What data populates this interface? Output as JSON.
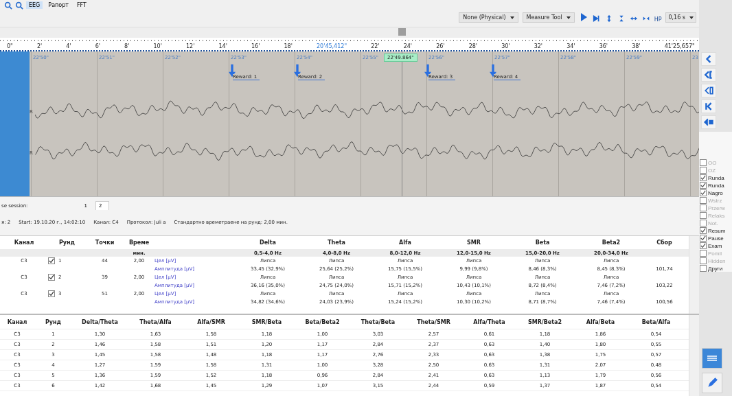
{
  "toolbar": {
    "buttons": [
      {
        "label": "EEG"
      },
      {
        "label": "Рапорт"
      },
      {
        "label": "FFT"
      }
    ],
    "montage": "None (Physical)",
    "tool": "Measure Tool",
    "hp_label": "HP",
    "hp_value": "0,16 s"
  },
  "ruler": {
    "ticks": [
      {
        "label": "0\"",
        "kind": "plain"
      },
      {
        "label": "2'",
        "kind": "plain"
      },
      {
        "label": "4'",
        "kind": "plain"
      },
      {
        "label": "6'",
        "kind": "plain"
      },
      {
        "label": "8'",
        "kind": "plain"
      },
      {
        "label": "10'",
        "kind": "plain"
      },
      {
        "label": "12'",
        "kind": "plain"
      },
      {
        "label": "14'",
        "kind": "plain"
      },
      {
        "label": "16'",
        "kind": "plain"
      },
      {
        "label": "18'",
        "kind": "plain"
      },
      {
        "label": "20'45,412\"",
        "kind": "current"
      },
      {
        "label": "22'",
        "kind": "plain"
      },
      {
        "label": "24'",
        "kind": "plain"
      },
      {
        "label": "26'",
        "kind": "plain"
      },
      {
        "label": "28'",
        "kind": "plain"
      },
      {
        "label": "30'",
        "kind": "plain"
      },
      {
        "label": "32'",
        "kind": "plain"
      },
      {
        "label": "34'",
        "kind": "plain"
      },
      {
        "label": "36'",
        "kind": "plain"
      },
      {
        "label": "38'",
        "kind": "plain"
      },
      {
        "label": "41'25,657\"",
        "kind": "plain"
      }
    ]
  },
  "eeg": {
    "time_labels": [
      "22'50\"",
      "22'51\"",
      "22'52\"",
      "22'53\"",
      "22'54\"",
      "22'55\"",
      "22'56\"",
      "22'57\"",
      "22'58\"",
      "22'59\"",
      "23"
    ],
    "cursor_time": "22'49.864\"",
    "markers": [
      "Reward: 1",
      "Reward: 2",
      "Reward: 3",
      "Reward: 4"
    ],
    "channels": [
      "R",
      "R"
    ]
  },
  "side_panel": {
    "checkboxes": [
      {
        "label": "OO",
        "checked": false,
        "disabled": true
      },
      {
        "label": "OZ",
        "checked": false,
        "disabled": true
      },
      {
        "label": "Runda",
        "checked": true,
        "disabled": false
      },
      {
        "label": "Runda",
        "checked": true,
        "disabled": false
      },
      {
        "label": "Nagro",
        "checked": true,
        "disabled": false
      },
      {
        "label": "Wstrz",
        "checked": false,
        "disabled": true
      },
      {
        "label": "Przerw",
        "checked": false,
        "disabled": true
      },
      {
        "label": "Relaks",
        "checked": false,
        "disabled": true
      },
      {
        "label": "Not.",
        "checked": false,
        "disabled": true
      },
      {
        "label": "Resum",
        "checked": true,
        "disabled": false
      },
      {
        "label": "Pause",
        "checked": true,
        "disabled": false
      },
      {
        "label": "Exam",
        "checked": true,
        "disabled": false
      },
      {
        "label": "Pomil",
        "checked": false,
        "disabled": true
      },
      {
        "label": "Hidden",
        "checked": false,
        "disabled": true
      },
      {
        "label": "Други",
        "checked": false,
        "disabled": false
      }
    ]
  },
  "session": {
    "label": "se session:",
    "tabs": [
      {
        "label": "1",
        "selected": false
      },
      {
        "label": "2",
        "selected": true
      }
    ],
    "info": [
      "я: 2",
      "Start: 19.10.20 г., 14:02:10",
      "Канал: C4",
      "Протокол: Juli a",
      "Стандартно времетраене на рунд: 2,00 мин."
    ]
  },
  "rounds_table": {
    "columns": [
      "Канал",
      "Рунд",
      "Точки",
      "Време",
      "Delta",
      "Theta",
      "Alfa",
      "SMR",
      "Beta",
      "Beta2",
      "Сбор"
    ],
    "time_unit": "мин.",
    "bands": [
      "0,5-4,0 Hz",
      "4,0-8,0 Hz",
      "8,0-12,0 Hz",
      "12,0-15,0 Hz",
      "15,0-20,0 Hz",
      "20,0-34,0 Hz"
    ],
    "rows": [
      {
        "channel": "C3",
        "round": "1",
        "checked": true,
        "points": "44",
        "time": "2,00",
        "target_label": "Цел [µV]",
        "amplitude_label": "Амплитуда [µV]",
        "targets": [
          "Липса",
          "Липса",
          "Липса",
          "Липса",
          "Липса",
          "Липса"
        ],
        "amplitudes": [
          "33,45 (32,9%)",
          "25,64 (25,2%)",
          "15,75 (15,5%)",
          "9,99 (9,8%)",
          "8,46 (8,3%)",
          "8,45 (8,3%)"
        ],
        "sum": "101,74"
      },
      {
        "channel": "C3",
        "round": "2",
        "checked": true,
        "points": "39",
        "time": "2,00",
        "target_label": "Цел [µV]",
        "amplitude_label": "Амплитуда [µV]",
        "targets": [
          "Липса",
          "Липса",
          "Липса",
          "Липса",
          "Липса",
          "Липса"
        ],
        "amplitudes": [
          "36,16 (35,0%)",
          "24,75 (24,0%)",
          "15,71 (15,2%)",
          "10,43 (10,1%)",
          "8,72 (8,4%)",
          "7,46 (7,2%)"
        ],
        "sum": "103,22"
      },
      {
        "channel": "C3",
        "round": "3",
        "checked": true,
        "points": "51",
        "time": "2,00",
        "target_label": "Цел [µV]",
        "amplitude_label": "Амплитуда [µV]",
        "targets": [
          "Липса",
          "Липса",
          "Липса",
          "Липса",
          "Липса",
          "Липса"
        ],
        "amplitudes": [
          "34,82 (34,6%)",
          "24,03 (23,9%)",
          "15,24 (15,2%)",
          "10,30 (10,2%)",
          "8,71 (8,7%)",
          "7,46 (7,4%)"
        ],
        "sum": "100,56"
      }
    ]
  },
  "ratio_table": {
    "columns": [
      "Канал",
      "Рунд",
      "Delta/Theta",
      "Theta/Alfa",
      "Alfa/SMR",
      "SMR/Beta",
      "Beta/Beta2",
      "Theta/Beta",
      "Theta/SMR",
      "Alfa/Theta",
      "SMR/Beta2",
      "Alfa/Beta",
      "Beta/Alfa"
    ],
    "rows": [
      [
        "C3",
        "1",
        "1,30",
        "1,63",
        "1,58",
        "1,18",
        "1,00",
        "3,03",
        "2,57",
        "0,61",
        "1,18",
        "1,86",
        "0,54"
      ],
      [
        "C3",
        "2",
        "1,46",
        "1,58",
        "1,51",
        "1,20",
        "1,17",
        "2,84",
        "2,37",
        "0,63",
        "1,40",
        "1,80",
        "0,55"
      ],
      [
        "C3",
        "3",
        "1,45",
        "1,58",
        "1,48",
        "1,18",
        "1,17",
        "2,76",
        "2,33",
        "0,63",
        "1,38",
        "1,75",
        "0,57"
      ],
      [
        "C3",
        "4",
        "1,27",
        "1,59",
        "1,58",
        "1,31",
        "1,00",
        "3,28",
        "2,50",
        "0,63",
        "1,31",
        "2,07",
        "0,48"
      ],
      [
        "C3",
        "5",
        "1,36",
        "1,59",
        "1,52",
        "1,18",
        "0,96",
        "2,84",
        "2,41",
        "0,63",
        "1,13",
        "1,79",
        "0,56"
      ],
      [
        "C3",
        "6",
        "1,42",
        "1,68",
        "1,45",
        "1,29",
        "1,07",
        "3,15",
        "2,44",
        "0,59",
        "1,37",
        "1,87",
        "0,54"
      ]
    ]
  }
}
